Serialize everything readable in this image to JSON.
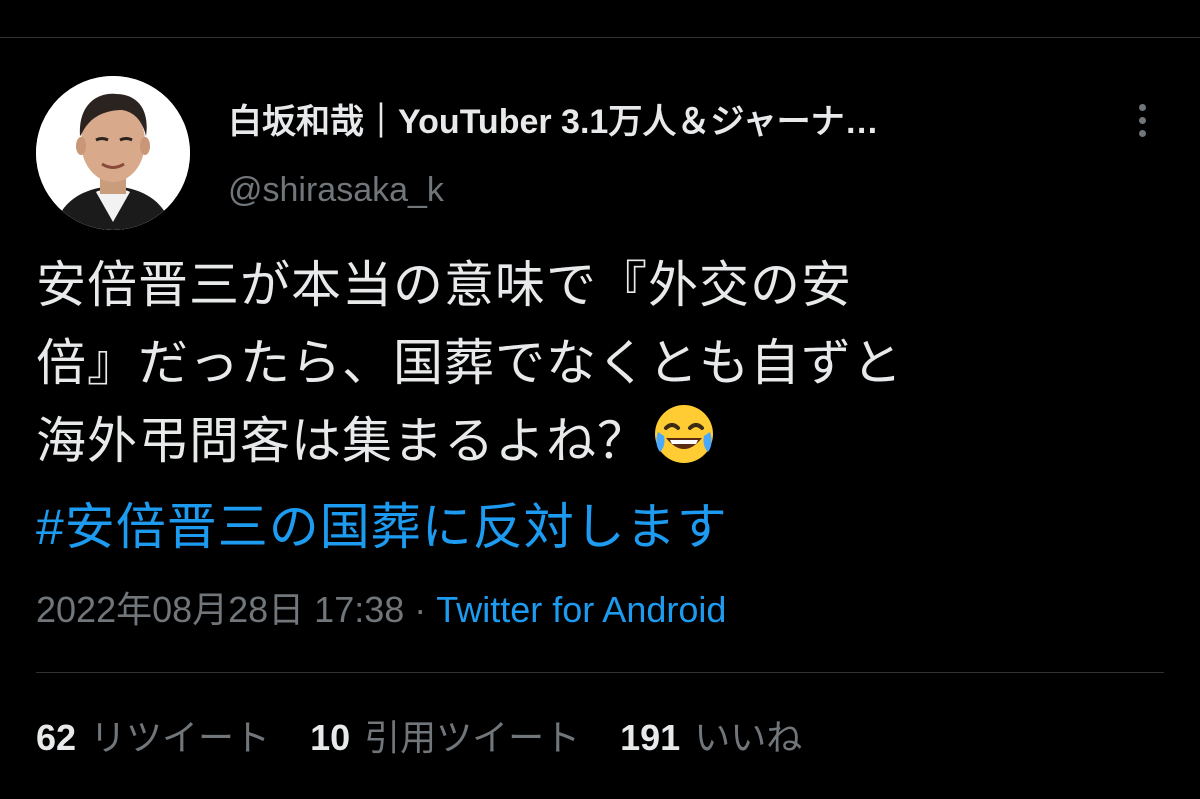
{
  "user": {
    "display_name": "白坂和哉｜YouTuber 3.1万人＆ジャーナ…",
    "handle": "@shirasaka_k",
    "avatar_icon": "user-avatar-photo"
  },
  "tweet": {
    "lines": [
      "安倍晋三が本当の意味で『外交の安",
      "倍』だったら、国葬でなくとも自ずと",
      "海外弔問客は集まるよね？"
    ],
    "emoji": "face-with-tears-of-joy",
    "hashtag": "#安倍晋三の国葬に反対します"
  },
  "meta": {
    "timestamp": "2022年08月28日 17:38",
    "separator": "·",
    "source": "Twitter for Android"
  },
  "stats": {
    "retweets": {
      "count": "62",
      "label": "リツイート"
    },
    "quotes": {
      "count": "10",
      "label": "引用ツイート"
    },
    "likes": {
      "count": "191",
      "label": "いいね"
    }
  },
  "colors": {
    "background": "#000000",
    "text": "#e7e9ea",
    "secondary": "#71767b",
    "link": "#1d9bf0",
    "divider": "#2f3336"
  }
}
